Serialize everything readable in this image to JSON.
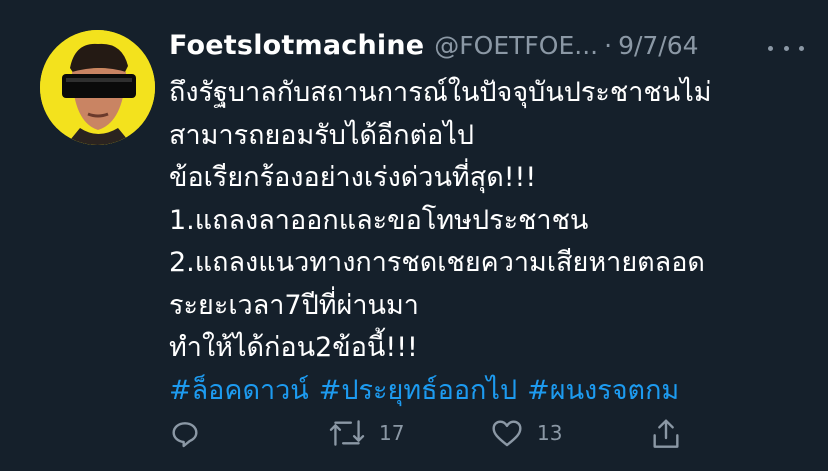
{
  "tweet": {
    "display_name": "Foetslotmachine",
    "handle": "@FOETFOE...",
    "separator": "·",
    "date": "9/7/64",
    "more_icon": "more-horizontal-icon",
    "lines": [
      "ถึงรัฐบาลกับสถานการณ์ในปัจจุบันประชาชนไม่",
      "สามารถยอมรับได้อีกต่อไป",
      "ข้อเรียกร้องอย่างเร่งด่วนที่สุด!!!",
      "1.แถลงลาออกและขอโทษประชาชน",
      "2.แถลงแนวทางการชดเชยความเสียหายตลอด",
      "ระยะเวลา7ปีที่ผ่านมา",
      "ทำให้ได้ก่อน2ข้อนี้!!!"
    ],
    "hashtags": [
      "#ล็อคดาวน์",
      "#ประยุทธ์ออกไป",
      "#ผนงรจตกม"
    ],
    "actions": {
      "reply_icon": "reply-icon",
      "retweet_icon": "retweet-icon",
      "retweet_count": "17",
      "like_icon": "heart-icon",
      "like_count": "13",
      "share_icon": "share-icon"
    }
  },
  "colors": {
    "background": "#15202b",
    "text": "#ffffff",
    "secondary": "#8b98a5",
    "accent": "#1d9bf0",
    "avatar_bg": "#f3e21d"
  }
}
